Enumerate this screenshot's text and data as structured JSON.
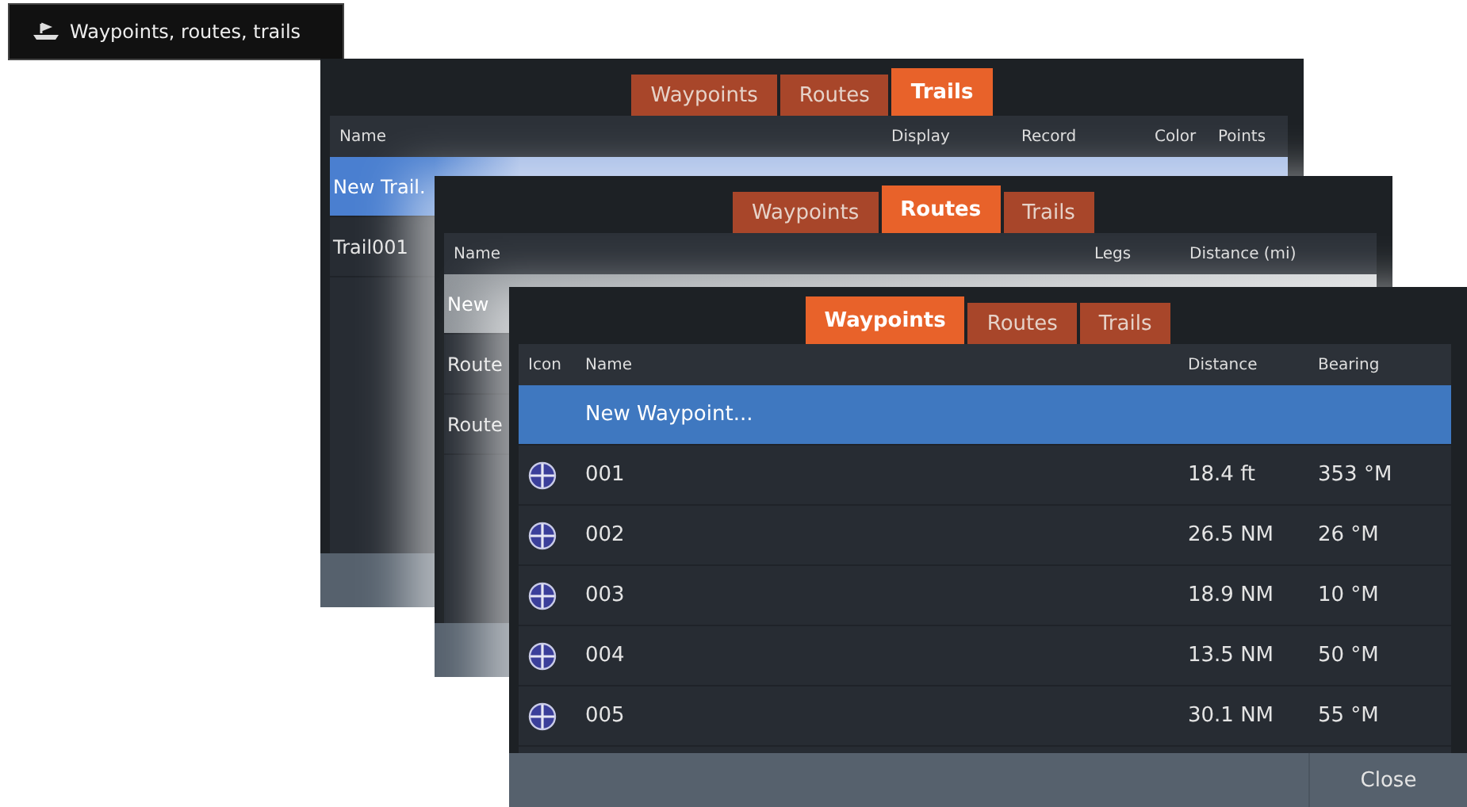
{
  "menu_button": {
    "label": "Waypoints, routes, trails"
  },
  "windows": [
    {
      "tabs": [
        {
          "label": "Waypoints",
          "selected": false
        },
        {
          "label": "Routes",
          "selected": false
        },
        {
          "label": "Trails",
          "selected": true
        }
      ],
      "columns": [
        "Name",
        "Display",
        "Record",
        "Color",
        "Points"
      ],
      "rows": [
        {
          "kind": "new",
          "name": "New Trail.",
          "selected": true
        },
        {
          "kind": "item",
          "name": "Trail001",
          "selected": false
        }
      ]
    },
    {
      "tabs": [
        {
          "label": "Waypoints",
          "selected": false
        },
        {
          "label": "Routes",
          "selected": true
        },
        {
          "label": "Trails",
          "selected": false
        }
      ],
      "columns": [
        "Name",
        "Legs",
        "Distance (mi)"
      ],
      "rows": [
        {
          "kind": "new",
          "name": "New",
          "selected": true
        },
        {
          "kind": "item",
          "name": "Route",
          "selected": false
        },
        {
          "kind": "item",
          "name": "Route",
          "selected": false
        }
      ]
    },
    {
      "tabs": [
        {
          "label": "Waypoints",
          "selected": true
        },
        {
          "label": "Routes",
          "selected": false
        },
        {
          "label": "Trails",
          "selected": false
        }
      ],
      "columns": [
        "Icon",
        "Name",
        "Distance",
        "Bearing"
      ],
      "rows": [
        {
          "kind": "new",
          "name": "New Waypoint...",
          "selected": true
        },
        {
          "kind": "waypoint",
          "name": "001",
          "distance": "18.4 ft",
          "bearing": "353 °M",
          "selected": false
        },
        {
          "kind": "waypoint",
          "name": "002",
          "distance": "26.5 NM",
          "bearing": "26 °M",
          "selected": false
        },
        {
          "kind": "waypoint",
          "name": "003",
          "distance": "18.9 NM",
          "bearing": "10 °M",
          "selected": false
        },
        {
          "kind": "waypoint",
          "name": "004",
          "distance": "13.5 NM",
          "bearing": "50 °M",
          "selected": false
        },
        {
          "kind": "waypoint",
          "name": "005",
          "distance": "30.1 NM",
          "bearing": "55 °M",
          "selected": false
        }
      ],
      "close_button": "Close"
    }
  ]
}
